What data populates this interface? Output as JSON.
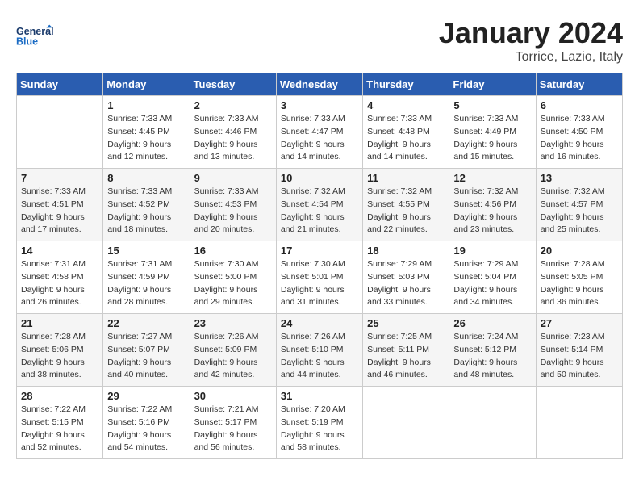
{
  "header": {
    "logo_general": "General",
    "logo_blue": "Blue",
    "month": "January 2024",
    "location": "Torrice, Lazio, Italy"
  },
  "days_of_week": [
    "Sunday",
    "Monday",
    "Tuesday",
    "Wednesday",
    "Thursday",
    "Friday",
    "Saturday"
  ],
  "weeks": [
    [
      {
        "num": "",
        "info": ""
      },
      {
        "num": "1",
        "info": "Sunrise: 7:33 AM\nSunset: 4:45 PM\nDaylight: 9 hours\nand 12 minutes."
      },
      {
        "num": "2",
        "info": "Sunrise: 7:33 AM\nSunset: 4:46 PM\nDaylight: 9 hours\nand 13 minutes."
      },
      {
        "num": "3",
        "info": "Sunrise: 7:33 AM\nSunset: 4:47 PM\nDaylight: 9 hours\nand 14 minutes."
      },
      {
        "num": "4",
        "info": "Sunrise: 7:33 AM\nSunset: 4:48 PM\nDaylight: 9 hours\nand 14 minutes."
      },
      {
        "num": "5",
        "info": "Sunrise: 7:33 AM\nSunset: 4:49 PM\nDaylight: 9 hours\nand 15 minutes."
      },
      {
        "num": "6",
        "info": "Sunrise: 7:33 AM\nSunset: 4:50 PM\nDaylight: 9 hours\nand 16 minutes."
      }
    ],
    [
      {
        "num": "7",
        "info": "Sunrise: 7:33 AM\nSunset: 4:51 PM\nDaylight: 9 hours\nand 17 minutes."
      },
      {
        "num": "8",
        "info": "Sunrise: 7:33 AM\nSunset: 4:52 PM\nDaylight: 9 hours\nand 18 minutes."
      },
      {
        "num": "9",
        "info": "Sunrise: 7:33 AM\nSunset: 4:53 PM\nDaylight: 9 hours\nand 20 minutes."
      },
      {
        "num": "10",
        "info": "Sunrise: 7:32 AM\nSunset: 4:54 PM\nDaylight: 9 hours\nand 21 minutes."
      },
      {
        "num": "11",
        "info": "Sunrise: 7:32 AM\nSunset: 4:55 PM\nDaylight: 9 hours\nand 22 minutes."
      },
      {
        "num": "12",
        "info": "Sunrise: 7:32 AM\nSunset: 4:56 PM\nDaylight: 9 hours\nand 23 minutes."
      },
      {
        "num": "13",
        "info": "Sunrise: 7:32 AM\nSunset: 4:57 PM\nDaylight: 9 hours\nand 25 minutes."
      }
    ],
    [
      {
        "num": "14",
        "info": "Sunrise: 7:31 AM\nSunset: 4:58 PM\nDaylight: 9 hours\nand 26 minutes."
      },
      {
        "num": "15",
        "info": "Sunrise: 7:31 AM\nSunset: 4:59 PM\nDaylight: 9 hours\nand 28 minutes."
      },
      {
        "num": "16",
        "info": "Sunrise: 7:30 AM\nSunset: 5:00 PM\nDaylight: 9 hours\nand 29 minutes."
      },
      {
        "num": "17",
        "info": "Sunrise: 7:30 AM\nSunset: 5:01 PM\nDaylight: 9 hours\nand 31 minutes."
      },
      {
        "num": "18",
        "info": "Sunrise: 7:29 AM\nSunset: 5:03 PM\nDaylight: 9 hours\nand 33 minutes."
      },
      {
        "num": "19",
        "info": "Sunrise: 7:29 AM\nSunset: 5:04 PM\nDaylight: 9 hours\nand 34 minutes."
      },
      {
        "num": "20",
        "info": "Sunrise: 7:28 AM\nSunset: 5:05 PM\nDaylight: 9 hours\nand 36 minutes."
      }
    ],
    [
      {
        "num": "21",
        "info": "Sunrise: 7:28 AM\nSunset: 5:06 PM\nDaylight: 9 hours\nand 38 minutes."
      },
      {
        "num": "22",
        "info": "Sunrise: 7:27 AM\nSunset: 5:07 PM\nDaylight: 9 hours\nand 40 minutes."
      },
      {
        "num": "23",
        "info": "Sunrise: 7:26 AM\nSunset: 5:09 PM\nDaylight: 9 hours\nand 42 minutes."
      },
      {
        "num": "24",
        "info": "Sunrise: 7:26 AM\nSunset: 5:10 PM\nDaylight: 9 hours\nand 44 minutes."
      },
      {
        "num": "25",
        "info": "Sunrise: 7:25 AM\nSunset: 5:11 PM\nDaylight: 9 hours\nand 46 minutes."
      },
      {
        "num": "26",
        "info": "Sunrise: 7:24 AM\nSunset: 5:12 PM\nDaylight: 9 hours\nand 48 minutes."
      },
      {
        "num": "27",
        "info": "Sunrise: 7:23 AM\nSunset: 5:14 PM\nDaylight: 9 hours\nand 50 minutes."
      }
    ],
    [
      {
        "num": "28",
        "info": "Sunrise: 7:22 AM\nSunset: 5:15 PM\nDaylight: 9 hours\nand 52 minutes."
      },
      {
        "num": "29",
        "info": "Sunrise: 7:22 AM\nSunset: 5:16 PM\nDaylight: 9 hours\nand 54 minutes."
      },
      {
        "num": "30",
        "info": "Sunrise: 7:21 AM\nSunset: 5:17 PM\nDaylight: 9 hours\nand 56 minutes."
      },
      {
        "num": "31",
        "info": "Sunrise: 7:20 AM\nSunset: 5:19 PM\nDaylight: 9 hours\nand 58 minutes."
      },
      {
        "num": "",
        "info": ""
      },
      {
        "num": "",
        "info": ""
      },
      {
        "num": "",
        "info": ""
      }
    ]
  ]
}
